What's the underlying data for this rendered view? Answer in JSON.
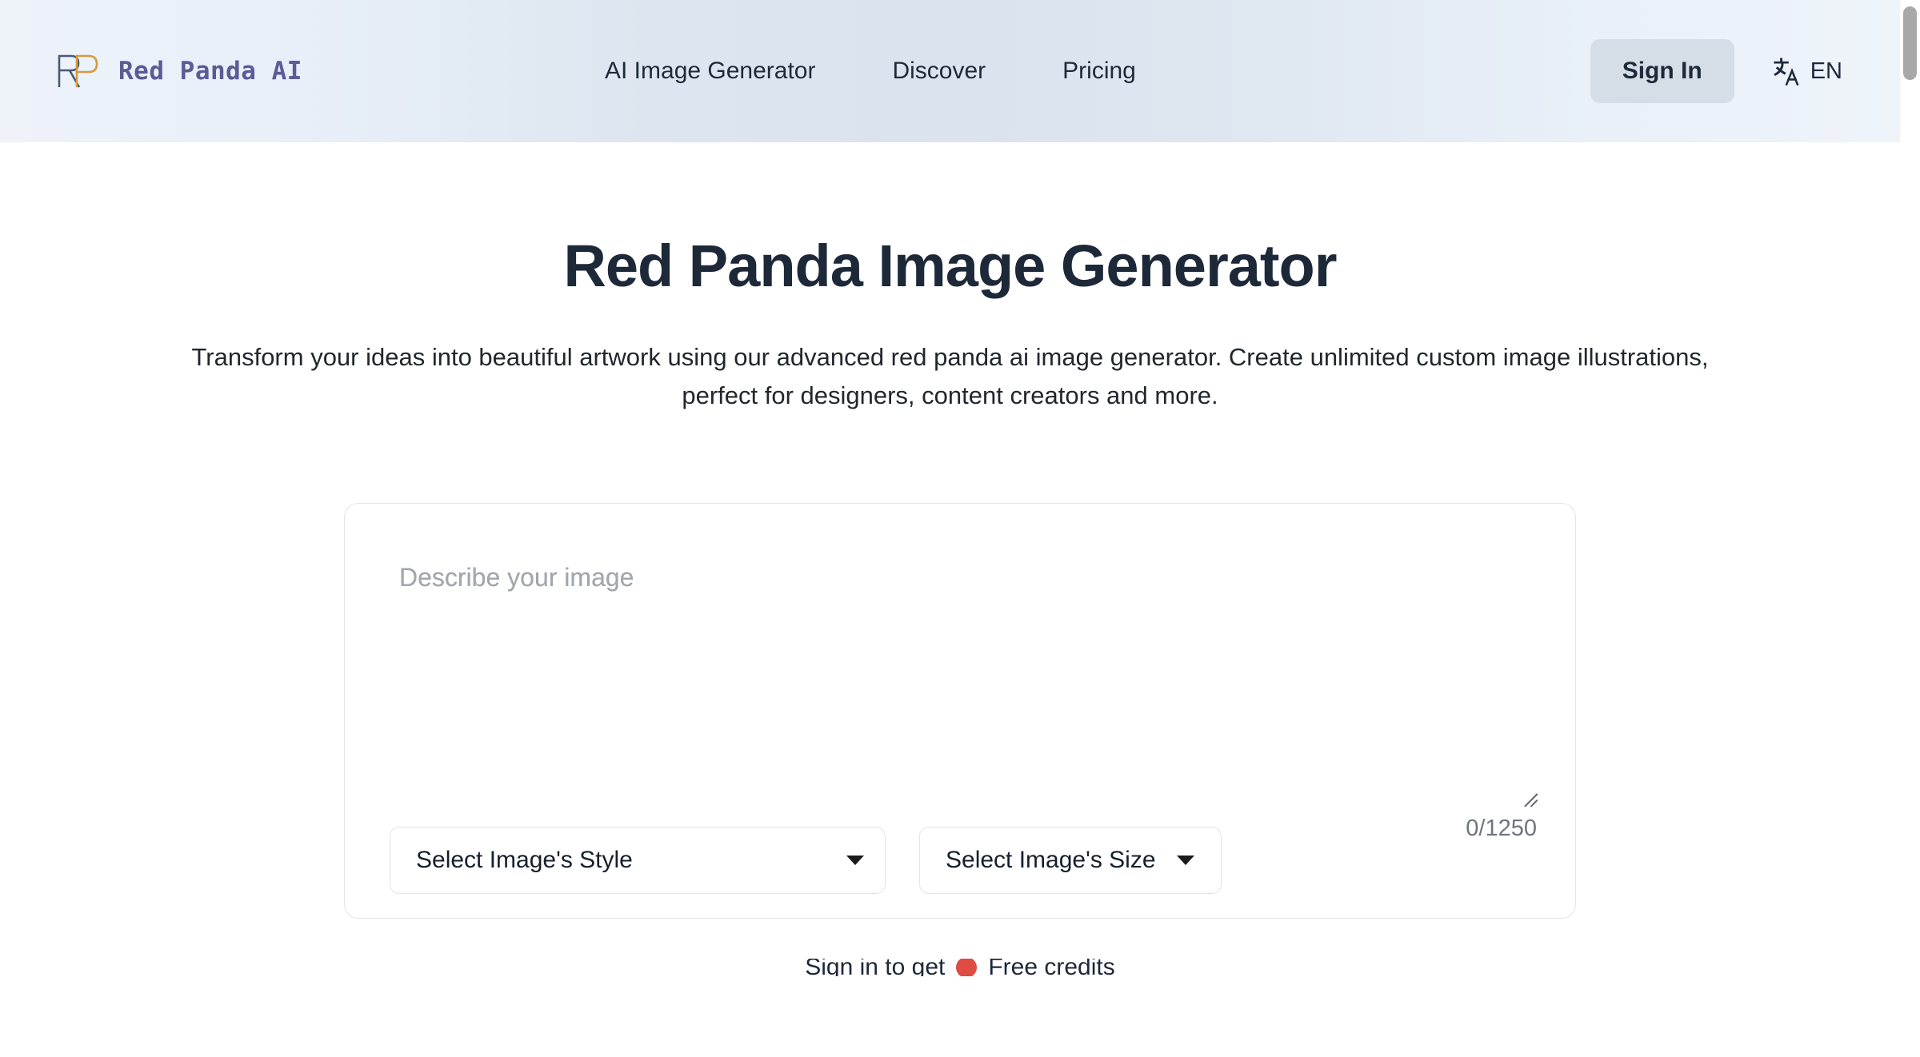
{
  "header": {
    "brand": {
      "logo_icon": "rp-monogram-icon",
      "name": "Red Panda AI",
      "logo_colors": {
        "letter_r": "#4a5a73",
        "letter_p": "#d79a3c"
      },
      "text_color": "#5b5b96"
    },
    "nav": [
      {
        "label": "AI Image Generator",
        "name": "nav-ai-image-generator"
      },
      {
        "label": "Discover",
        "name": "nav-discover"
      },
      {
        "label": "Pricing",
        "name": "nav-pricing"
      }
    ],
    "sign_in_label": "Sign In",
    "language": {
      "icon": "translate-icon",
      "code": "EN"
    },
    "background_gradient": [
      "#eef3fa",
      "#dae3ee",
      "#eff4fb"
    ]
  },
  "hero": {
    "title": "Red Panda Image Generator",
    "subtitle": "Transform your ideas into beautiful artwork using our advanced red panda ai image generator. Create unlimited custom image illustrations, perfect for designers, content creators and more.",
    "title_color": "#1d2838"
  },
  "generator": {
    "prompt": {
      "value": "",
      "placeholder": "Describe your image",
      "resize_handle_icon": "resize-grip-icon"
    },
    "style_select": {
      "label": "Select Image's Style",
      "caret_icon": "chevron-down-icon"
    },
    "size_select": {
      "label": "Select Image's Size",
      "caret_icon": "chevron-down-icon"
    },
    "char_counter": "0/1250"
  },
  "promo": {
    "text_before": "Sign in to get",
    "badge_icon": "red-credit-dot-icon",
    "text_after": "Free credits"
  },
  "scrollbar": {
    "thumb_color": "#a8a8a8",
    "track_color": "#ffffff"
  }
}
